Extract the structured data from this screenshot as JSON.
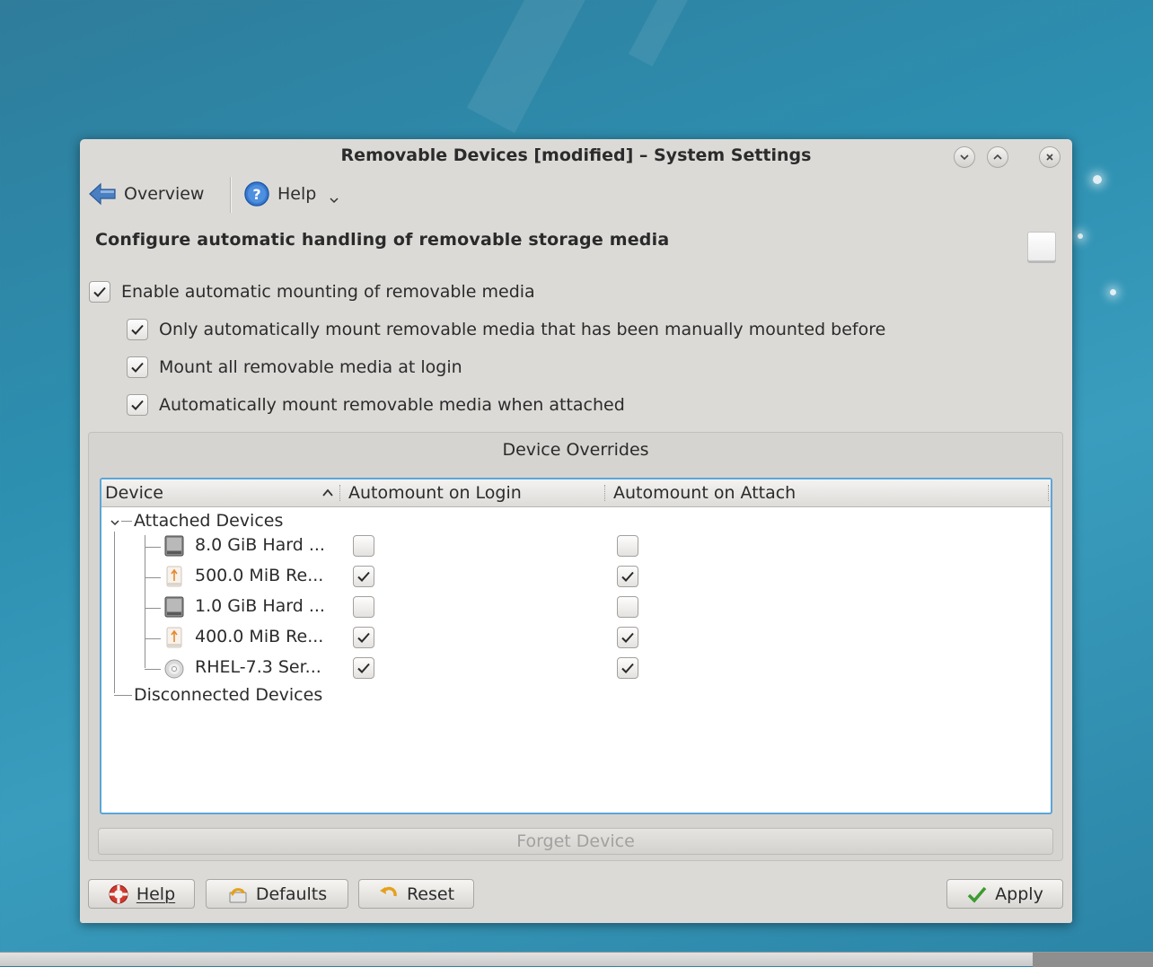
{
  "window": {
    "title": "Removable Devices [modified] – System Settings"
  },
  "toolbar": {
    "overview_label": "Overview",
    "help_label": "Help"
  },
  "page": {
    "heading": "Configure automatic handling of removable storage media"
  },
  "options": {
    "enable_automount": {
      "label": "Enable automatic mounting of removable media",
      "checked": true
    },
    "only_manual_before": {
      "label": "Only automatically mount removable media that has been manually mounted before",
      "checked": true
    },
    "mount_at_login": {
      "label": "Mount all removable media at login",
      "checked": true
    },
    "mount_on_attach": {
      "label": "Automatically mount removable media when attached",
      "checked": true
    }
  },
  "overrides": {
    "group_title": "Device Overrides",
    "columns": [
      "Device",
      "Automount on Login",
      "Automount on Attach"
    ],
    "attached_label": "Attached Devices",
    "disconnected_label": "Disconnected Devices",
    "devices": [
      {
        "name": "8.0 GiB Hard ...",
        "icon": "hard-disk-icon",
        "login": false,
        "attach": false
      },
      {
        "name": "500.0 MiB Re...",
        "icon": "usb-drive-icon",
        "login": true,
        "attach": true
      },
      {
        "name": "1.0 GiB Hard ...",
        "icon": "hard-disk-icon",
        "login": false,
        "attach": false
      },
      {
        "name": "400.0 MiB Re...",
        "icon": "usb-drive-icon",
        "login": true,
        "attach": true
      },
      {
        "name": "RHEL-7.3 Ser...",
        "icon": "optical-disc-icon",
        "login": true,
        "attach": true
      }
    ],
    "forget_label": "Forget Device"
  },
  "buttons": {
    "help": "Help",
    "defaults": "Defaults",
    "reset": "Reset",
    "apply": "Apply"
  },
  "colors": {
    "accent": "#5aa6d6",
    "apply_check": "#3c9b2f",
    "desktop": "#2d8fb0"
  }
}
